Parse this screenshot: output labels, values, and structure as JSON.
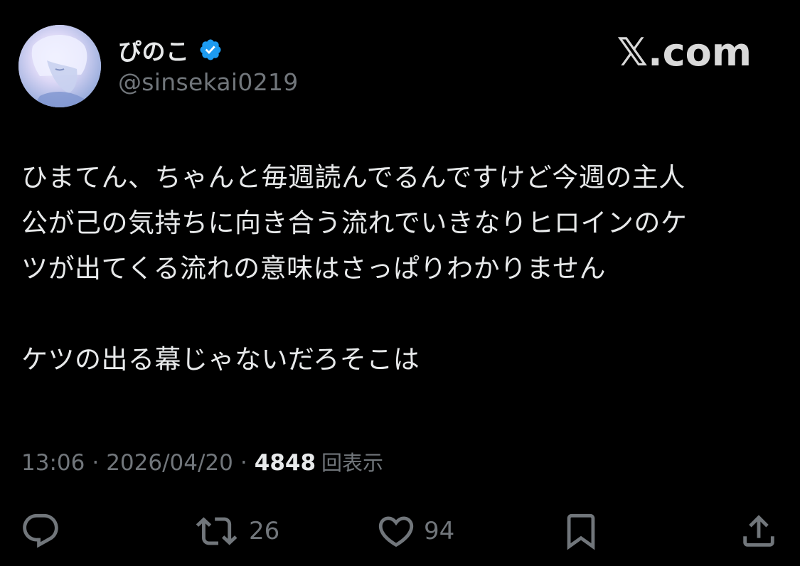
{
  "author": {
    "display_name": "ぴのこ",
    "handle": "@sinsekai0219",
    "verified": true,
    "verified_color": "#1d9bf0"
  },
  "brand": "𝕏.com",
  "tweet": {
    "paragraphs": [
      "ひまてん、ちゃんと毎週読んでるんですけど今週の主人公が己の気持ちに向き合う流れでいきなりヒロインのケツが出てくる流れの意味はさっぱりわかりません",
      "ケツの出る幕じゃないだろそこは"
    ],
    "line1": "ひまてん、ちゃんと毎週読んでるんですけど今週の主人",
    "line2": "公が己の気持ちに向き合う流れでいきなりヒロインのケ",
    "line3": "ツが出てくる流れの意味はさっぱりわかりません",
    "line4": "ケツの出る幕じゃないだろそこは"
  },
  "meta": {
    "time": "13:06",
    "separator": "·",
    "date": "2026/04/20",
    "views_count": "4848",
    "views_label": "回表示"
  },
  "actions": {
    "reply": {
      "icon": "reply-icon",
      "count": ""
    },
    "retweet": {
      "icon": "retweet-icon",
      "count": "26"
    },
    "like": {
      "icon": "heart-icon",
      "count": "94"
    },
    "bookmark": {
      "icon": "bookmark-icon",
      "count": ""
    },
    "share": {
      "icon": "share-icon",
      "count": ""
    }
  },
  "colors": {
    "background": "#000000",
    "text_primary": "#e7e9ea",
    "text_secondary": "#71767b",
    "accent": "#1d9bf0"
  }
}
